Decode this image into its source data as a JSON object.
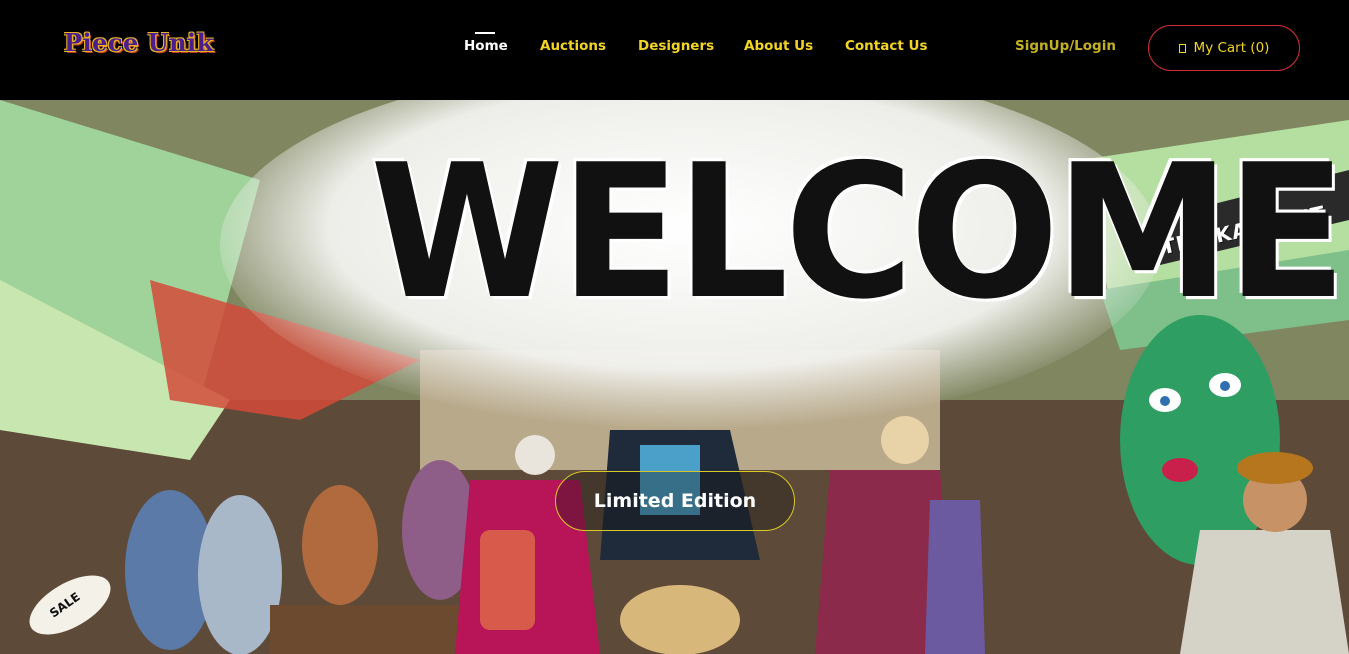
{
  "header": {
    "logo": "Piece Unik",
    "nav": [
      {
        "label": "Home",
        "active": true
      },
      {
        "label": "Auctions",
        "active": false
      },
      {
        "label": "Designers",
        "active": false
      },
      {
        "label": "About Us",
        "active": false
      },
      {
        "label": "Contact Us",
        "active": false
      }
    ],
    "signup_label": "SignUp/Login",
    "cart_label": "My Cart (0)"
  },
  "hero": {
    "welcome_text": "WELCOME",
    "cta_label": "Limited Edition",
    "sign_text": "THE KARPENT",
    "sale_text": "SALE"
  },
  "colors": {
    "nav_text": "#f2d524",
    "nav_active": "#ffffff",
    "cart_border": "#d32b3a",
    "cta_border": "#d9c928",
    "header_bg": "#000000"
  },
  "icons": {
    "cart": "cart-icon"
  }
}
